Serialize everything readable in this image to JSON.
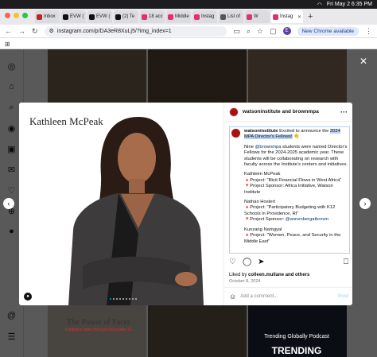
{
  "mac_menu": {
    "date_time": "Fri May 2  6:35 PM"
  },
  "browser": {
    "tabs": [
      {
        "label": "Inbox",
        "color": "#c5221f"
      },
      {
        "label": "EVW (",
        "color": "#111111"
      },
      {
        "label": "EVW (",
        "color": "#111111"
      },
      {
        "label": "(2) Te",
        "color": "#111111"
      },
      {
        "label": "18 acc",
        "color": "#e1306c"
      },
      {
        "label": "Middle",
        "color": "#e1306c"
      },
      {
        "label": "Instag",
        "color": "#e1306c"
      },
      {
        "label": "List of",
        "color": "#555555"
      },
      {
        "label": "W",
        "color": "#e1306c"
      },
      {
        "label": "Instag",
        "color": "#e1306c"
      }
    ],
    "url": "instagram.com/p/DA3eR8XuLj5/?img_index=1",
    "new_chrome_label": "New Chrome available",
    "profile_initial": "E"
  },
  "modal": {
    "photo_name": "Kathleen McPeak",
    "header_account": "watsoninstitute and brownmpa",
    "caption": {
      "account": "watsoninstitute",
      "intro": "Excited to announce the ",
      "intro_highlight_1": "2024",
      "intro_highlight_2": "MPA Director's Fellows!",
      "intro_end": " 👏",
      "p2_a": "Nine ",
      "p2_mention": "@brownmpa",
      "p2_b": " students were named Director's Fellows for the 2024-2025 academic year. These students will be collaborating on research with faculty across the Institute's centers and initiatives.",
      "f1_name": "Kathleen McPeak",
      "f1_project": "🔺Project: \"Illicit Financial Flows in West Africa\"",
      "f1_sponsor": "🔻Project Sponsor: Africa Initiative, Watson Institute",
      "f2_name": "Nathan Hostert",
      "f2_project": "🔺Project: \"Participatory Budgeting with K12 Schools in Providence, RI\"",
      "f2_sponsor_a": "🔻Project Sponsor: ",
      "f2_sponsor_mention": "@annenbergatbrown",
      "f3_name": "Kunzang Namgyal",
      "f3_project": "🔺Project: \"Women, Peace, and Security in the Middle East\""
    },
    "liked_by_prefix": "Liked by ",
    "liked_by_user": "colleen.mullane",
    "liked_by_suffix": " and others",
    "date": "October 8, 2024",
    "comment_placeholder": "Add a comment...",
    "post_label": "Post"
  },
  "background_tiles": {
    "tile1_title": "The Power of Faces",
    "tile1_sub": "Exhibition open through December 31",
    "tile3_title": "Trending Globally Podcast",
    "tile3_sub": "TRENDING"
  }
}
